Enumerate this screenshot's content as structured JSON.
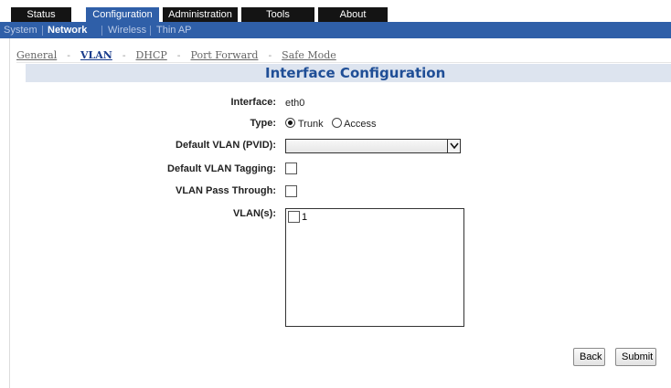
{
  "top_tabs": [
    "Status",
    "Configuration",
    "Administration",
    "Tools",
    "About"
  ],
  "active_top_tab": "Configuration",
  "sub_tabs": [
    "System",
    "Network",
    "Wireless",
    "Thin AP"
  ],
  "active_sub_tab": "Network",
  "nav_links": [
    "General",
    "VLAN",
    "DHCP",
    "Port Forward",
    "Safe Mode"
  ],
  "nav_separator": "-",
  "active_nav": "VLAN",
  "page_title": "Interface Configuration",
  "form": {
    "interface_label": "Interface:",
    "interface_value": "eth0",
    "type_label": "Type:",
    "type_options": [
      "Trunk",
      "Access"
    ],
    "type_selected": "Trunk",
    "pvid_label": "Default VLAN (PVID):",
    "pvid_value": "",
    "tagging_label": "Default VLAN Tagging:",
    "tagging_checked": false,
    "pass_through_label": "VLAN Pass Through:",
    "pass_through_checked": false,
    "vlans_label": "VLAN(s):",
    "vlans": [
      {
        "id": "1",
        "checked": false
      }
    ]
  },
  "buttons": {
    "back": "Back",
    "submit": "Submit"
  },
  "colors": {
    "nav_blue": "#2f5fa8",
    "title_blue": "#1f4e96",
    "title_bar": "#dde4ef",
    "top_tab": "#141414"
  }
}
